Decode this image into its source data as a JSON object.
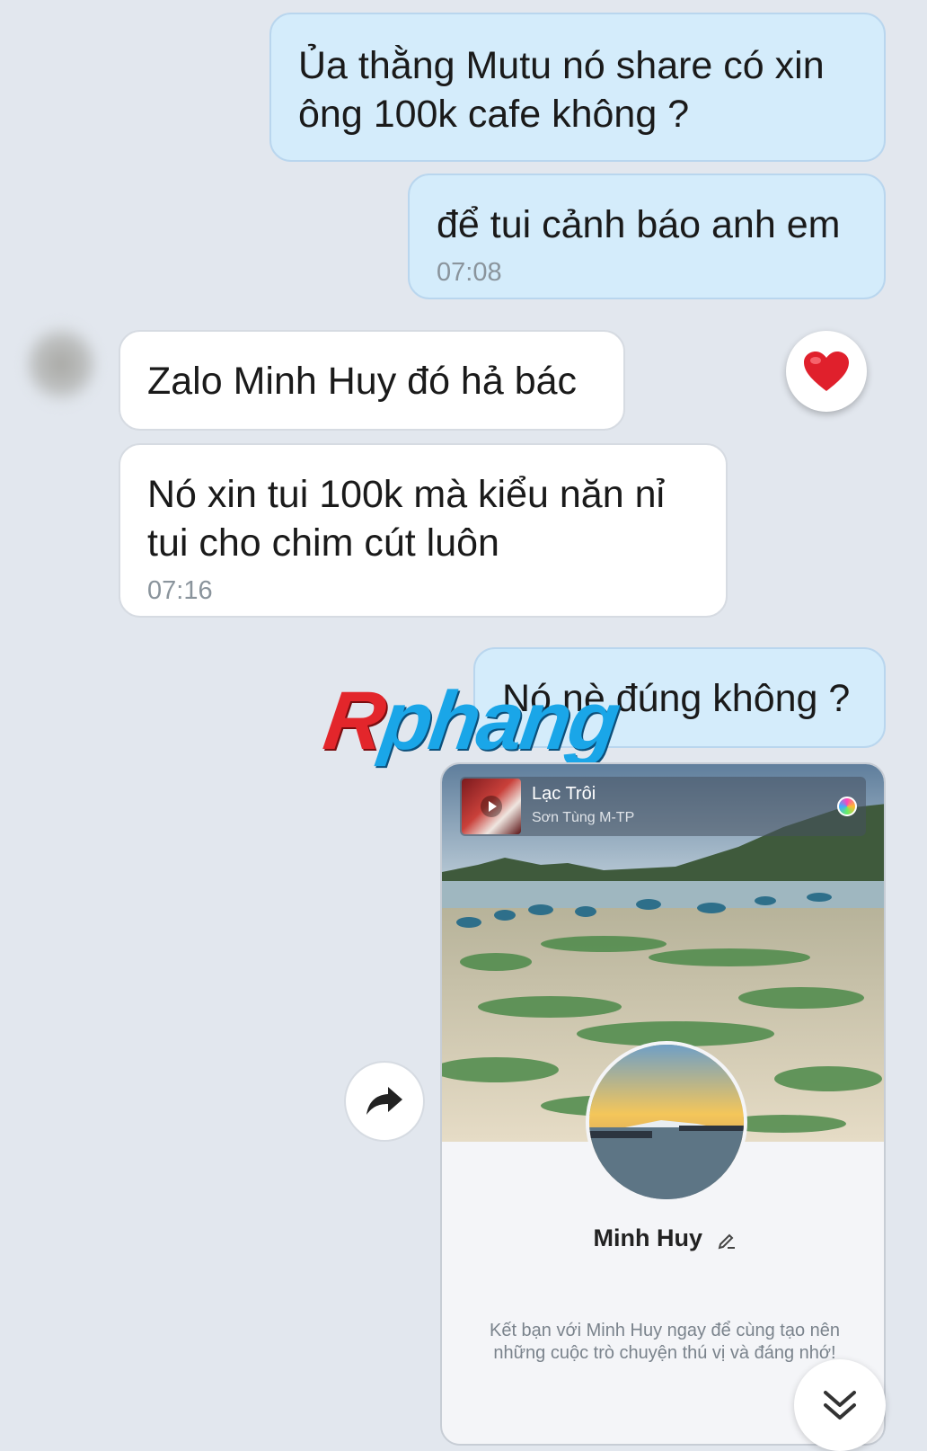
{
  "messages": [
    {
      "id": "b1",
      "direction": "sent",
      "text": "Ủa thằng Mutu nó share có xin ông 100k cafe không ?"
    },
    {
      "id": "b2",
      "direction": "sent",
      "text": "để tui cảnh báo anh em",
      "time": "07:08"
    },
    {
      "id": "b3",
      "direction": "received",
      "text": "Zalo Minh Huy đó hả bác"
    },
    {
      "id": "b4",
      "direction": "received",
      "text": "Nó xin tui 100k mà kiểu năn nỉ tui cho chim cút luôn",
      "time": "07:16"
    },
    {
      "id": "b5",
      "direction": "sent",
      "text": "Nó nè đúng không ?"
    }
  ],
  "reaction": {
    "icon": "heart-icon"
  },
  "watermark": {
    "part1": "R",
    "part2": "phang"
  },
  "profile_card": {
    "music_title": "Lạc Trôi",
    "music_artist": "Sơn Tùng M-TP",
    "name": "Minh Huy",
    "description": "Kết bạn với Minh Huy ngay để cùng tạo nên những cuộc trò chuyện thú vị và đáng nhớ!"
  },
  "colors": {
    "sent_bubble": "#d4ecfb",
    "received_bubble": "#ffffff",
    "background": "#e2e7ee",
    "heart": "#e0202c"
  }
}
